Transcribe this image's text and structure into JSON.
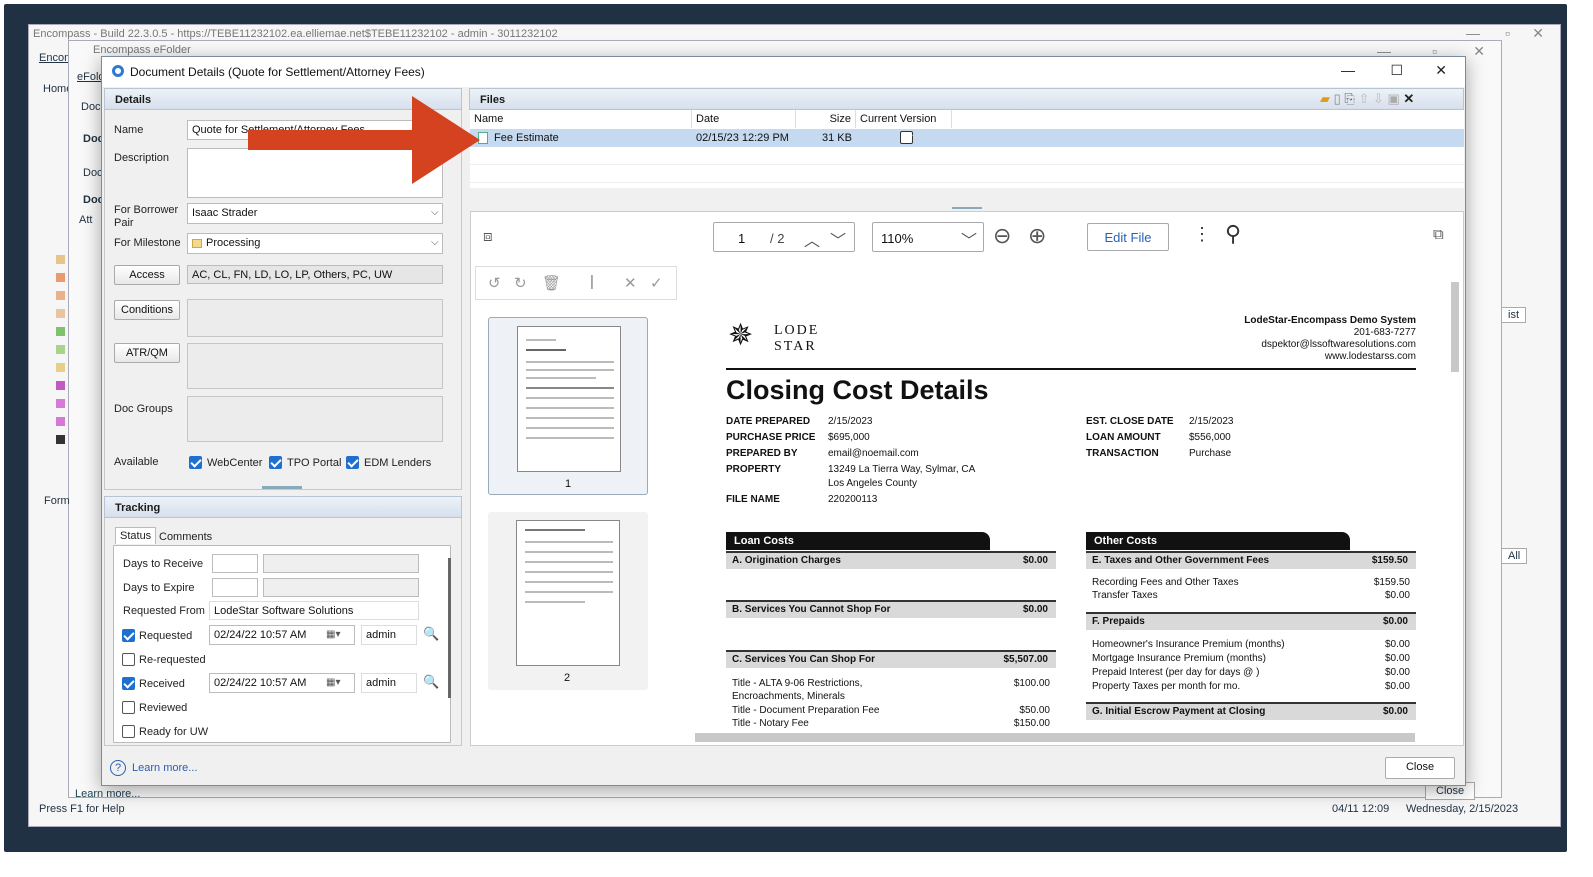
{
  "main_window": {
    "title": "Encompass - Build 22.3.0.5 - https://TEBE11232102.ea.elliemae.net$TEBE11232102 - admin - 3011232102",
    "menu_first": "Encom",
    "tab_first": "Home"
  },
  "efolder_window": {
    "title": "Encompass eFolder",
    "menu_first": "eFold",
    "tab_first": "Doc",
    "help_label": "Learn more...",
    "close_label": "Close"
  },
  "background_labels": {
    "doc1": "Doc",
    "doc2": "Doc",
    "doc3": "Doc",
    "att": "Att",
    "form": "Form",
    "list_btn": "ist",
    "all_btn": "All",
    "status_left": "Press F1 for Help",
    "status_time": "04/11 12:09",
    "status_date": "Wednesday, 2/15/2023"
  },
  "dialog": {
    "title": "Document Details (Quote for Settlement/Attorney Fees)",
    "details": {
      "header": "Details",
      "name_label": "Name",
      "name_value": "Quote for Settlement/Attorney Fees",
      "description_label": "Description",
      "borrower_label": "For Borrower Pair",
      "borrower_value": "Isaac Strader",
      "milestone_label": "For Milestone",
      "milestone_value": "Processing",
      "access_button": "Access",
      "access_value": "AC, CL, FN, LD, LO, LP, Others, PC, UW",
      "conditions_button": "Conditions",
      "atrqm_button": "ATR/QM",
      "docgroups_label": "Doc Groups",
      "available_label": "Available",
      "available": [
        {
          "label": "WebCenter",
          "checked": true
        },
        {
          "label": "TPO Portal",
          "checked": true
        },
        {
          "label": "EDM Lenders",
          "checked": true
        }
      ]
    },
    "tracking": {
      "header": "Tracking",
      "tabs": [
        "Status",
        "Comments"
      ],
      "days_receive_label": "Days to Receive",
      "days_expire_label": "Days to Expire",
      "requested_from_label": "Requested From",
      "requested_from_value": "LodeStar Software Solutions",
      "requested": {
        "label": "Requested",
        "checked": true,
        "date": "02/24/22 10:57 AM",
        "user": "admin"
      },
      "rerequested": {
        "label": "Re-requested",
        "checked": false
      },
      "received": {
        "label": "Received",
        "checked": true,
        "date": "02/24/22 10:57 AM",
        "user": "admin"
      },
      "reviewed": {
        "label": "Reviewed",
        "checked": false
      },
      "ready_uw": {
        "label": "Ready for UW",
        "checked": false
      }
    },
    "files": {
      "header": "Files",
      "columns": [
        "Name",
        "Date",
        "Size",
        "Current Version"
      ],
      "rows": [
        {
          "name": "Fee Estimate",
          "date": "02/15/23 12:29 PM",
          "size": "31 KB",
          "current": true
        }
      ]
    },
    "viewer": {
      "page_current": "1",
      "page_total": "/ 2",
      "zoom": "110%",
      "edit_button": "Edit File",
      "thumb_labels": [
        "1",
        "2"
      ]
    },
    "help_label": "Learn more...",
    "close_label": "Close"
  },
  "document": {
    "logo_line1": "LODE",
    "logo_line2": "STAR",
    "company": "LodeStar-Encompass Demo System",
    "phone": "201-683-7277",
    "email": "dspektor@lssoftwaresolutions.com",
    "website": "www.lodestarss.com",
    "title": "Closing Cost Details",
    "left_info": [
      {
        "k": "DATE PREPARED",
        "v": "2/15/2023"
      },
      {
        "k": "PURCHASE PRICE",
        "v": "$695,000"
      },
      {
        "k": "PREPARED BY",
        "v": "email@noemail.com"
      },
      {
        "k": "PROPERTY",
        "v": "13249 La Tierra Way, Sylmar, CA"
      },
      {
        "k": "",
        "v": "Los Angeles County"
      },
      {
        "k": "FILE NAME",
        "v": "220200113"
      }
    ],
    "right_info": [
      {
        "k": "EST. CLOSE DATE",
        "v": "2/15/2023"
      },
      {
        "k": "LOAN AMOUNT",
        "v": "$556,000"
      },
      {
        "k": "TRANSACTION",
        "v": "Purchase"
      }
    ],
    "loan_costs": {
      "header": "Loan Costs",
      "a": {
        "label": "A. Origination Charges",
        "amount": "$0.00"
      },
      "b": {
        "label": "B. Services You Cannot Shop For",
        "amount": "$0.00"
      },
      "c": {
        "label": "C. Services You Can Shop For",
        "amount": "$5,507.00"
      },
      "c_items": [
        {
          "label": "Title - ALTA 9-06 Restrictions,",
          "amount": "$100.00"
        },
        {
          "label": "Encroachments, Minerals",
          "amount": ""
        },
        {
          "label": "Title - Document Preparation Fee",
          "amount": "$50.00"
        },
        {
          "label": "Title - Notary Fee",
          "amount": "$150.00"
        }
      ]
    },
    "other_costs": {
      "header": "Other Costs",
      "e": {
        "label": "E. Taxes and Other Government Fees",
        "amount": "$159.50"
      },
      "e_items": [
        {
          "label": "Recording Fees and Other Taxes",
          "amount": "$159.50"
        },
        {
          "label": "Transfer Taxes",
          "amount": "$0.00"
        }
      ],
      "f": {
        "label": "F. Prepaids",
        "amount": "$0.00"
      },
      "f_items": [
        {
          "label": "Homeowner's Insurance Premium (months)",
          "amount": "$0.00"
        },
        {
          "label": "Mortgage Insurance Premium (months)",
          "amount": "$0.00"
        },
        {
          "label": "Prepaid Interest (per day for days @ )",
          "amount": "$0.00"
        },
        {
          "label": "Property Taxes per month for mo.",
          "amount": "$0.00"
        }
      ],
      "g": {
        "label": "G. Initial Escrow Payment at Closing",
        "amount": "$0.00"
      }
    }
  },
  "colors": {
    "arrow": "#d4421f",
    "accent": "#1f6fd0",
    "frame": "#1f3143",
    "selected_row": "#c5d9f1"
  }
}
